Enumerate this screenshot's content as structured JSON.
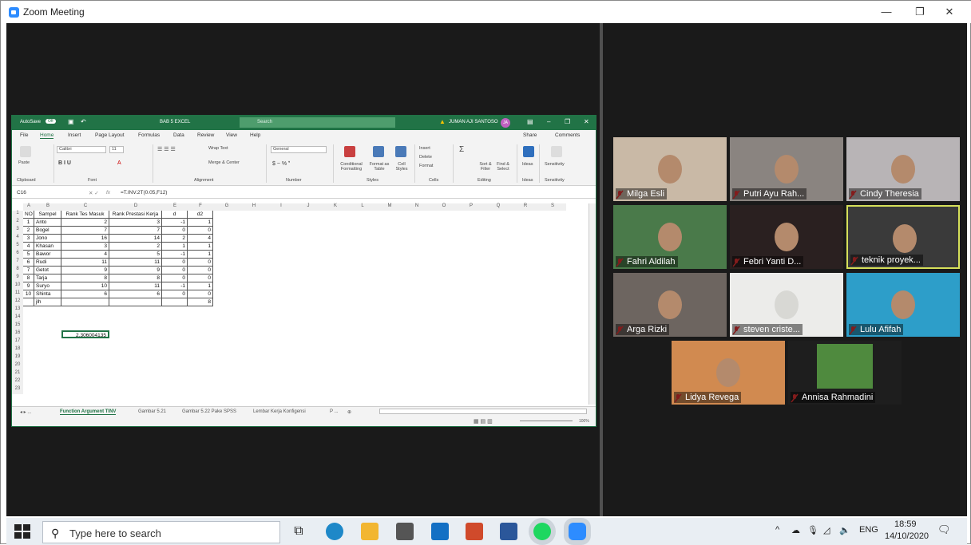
{
  "window": {
    "title": "Zoom Meeting",
    "minimize": "—",
    "restore": "❐",
    "close": "✕"
  },
  "excel": {
    "autosave": "AutoSave",
    "autosave_state": "Off",
    "file_title": "BAB 5 EXCEL",
    "search_placeholder": "Search",
    "user": "JUMAN AJI SANTOSO",
    "user_initials": "JA",
    "menus": [
      "File",
      "Home",
      "Insert",
      "Page Layout",
      "Formulas",
      "Data",
      "Review",
      "View",
      "Help"
    ],
    "share": "Share",
    "comments": "Comments",
    "ribbon": {
      "paste": "Paste",
      "clipboard": "Clipboard",
      "font_name": "Calibri",
      "font_size": "11",
      "font": "Font",
      "wrap_text": "Wrap Text",
      "merge_center": "Merge & Center",
      "alignment": "Alignment",
      "number_format": "General",
      "number": "Number",
      "conditional": "Conditional Formatting",
      "format_table": "Format as Table",
      "cell_styles": "Cell Styles",
      "styles": "Styles",
      "insert": "Insert",
      "delete": "Delete",
      "format": "Format",
      "cells": "Cells",
      "sort_filter": "Sort & Filter",
      "find_select": "Find & Select",
      "editing": "Editing",
      "ideas": "Ideas",
      "sensitivity": "Sensitivity"
    },
    "name_box": "C16",
    "formula": "=T.INV.2T(0.05,F12)",
    "columns": [
      "A",
      "B",
      "C",
      "D",
      "E",
      "F",
      "G",
      "H",
      "I",
      "J",
      "K",
      "L",
      "M",
      "N",
      "O",
      "P",
      "Q",
      "R",
      "S"
    ],
    "rows": [
      "1",
      "2",
      "3",
      "4",
      "5",
      "6",
      "7",
      "8",
      "9",
      "10",
      "11",
      "12",
      "13",
      "14",
      "15",
      "16",
      "17",
      "18",
      "19",
      "20",
      "21",
      "22",
      "23"
    ],
    "headers": [
      "NO",
      "Sampel",
      "Rank Tes Masuk",
      "Rank Prestasi Kerja",
      "d",
      "d2"
    ],
    "table": [
      [
        "1",
        "Anto",
        "2",
        "3",
        "-1",
        "1"
      ],
      [
        "2",
        "Bogel",
        "7",
        "7",
        "0",
        "0"
      ],
      [
        "3",
        "Jono",
        "16",
        "14",
        "2",
        "4"
      ],
      [
        "4",
        "Khasan",
        "3",
        "2",
        "1",
        "1"
      ],
      [
        "5",
        "Bawor",
        "4",
        "5",
        "-1",
        "1"
      ],
      [
        "6",
        "Rudi",
        "11",
        "11",
        "0",
        "0"
      ],
      [
        "7",
        "Getot",
        "9",
        "9",
        "0",
        "0"
      ],
      [
        "8",
        "Tarja",
        "8",
        "8",
        "0",
        "0"
      ],
      [
        "9",
        "Suryo",
        "10",
        "11",
        "-1",
        "1"
      ],
      [
        "10",
        "Shinta",
        "6",
        "6",
        "0",
        "0"
      ]
    ],
    "total_label": "jlh",
    "total_value": "8",
    "result_value": "2.306004135",
    "sheet_tabs": [
      "Function Argument TINV",
      "Gambar 5.21",
      "Gambar 5.22 Pake SPSS",
      "Lembar Kerja Konfigensi",
      "P ..."
    ],
    "zoom": "100%"
  },
  "participants": [
    {
      "name": "Milga Esli",
      "bg": "#c9b9a6"
    },
    {
      "name": "Putri Ayu Rah...",
      "bg": "#8a8480"
    },
    {
      "name": "Cindy Theresia",
      "bg": "#b8b4b6"
    },
    {
      "name": "Fahri Aldilah",
      "bg": "#4a7a4a"
    },
    {
      "name": "Febri Yanti D...",
      "bg": "#2a2020"
    },
    {
      "name": "teknik proyek...",
      "bg": "#3a3a3a"
    },
    {
      "name": "Arga Rizki",
      "bg": "#6d6560"
    },
    {
      "name": "steven criste...",
      "bg": "#ececea"
    },
    {
      "name": "Lulu Afifah",
      "bg": "#2d9ec9"
    },
    {
      "name": "Lidya Revega",
      "bg": "#d18a50"
    },
    {
      "name": "Annisa Rahmadini",
      "bg": "#1e1e1e"
    }
  ],
  "taskbar": {
    "search_placeholder": "Type here to search",
    "lang": "ENG",
    "time": "18:59",
    "date": "14/10/2020",
    "notif": "1"
  }
}
